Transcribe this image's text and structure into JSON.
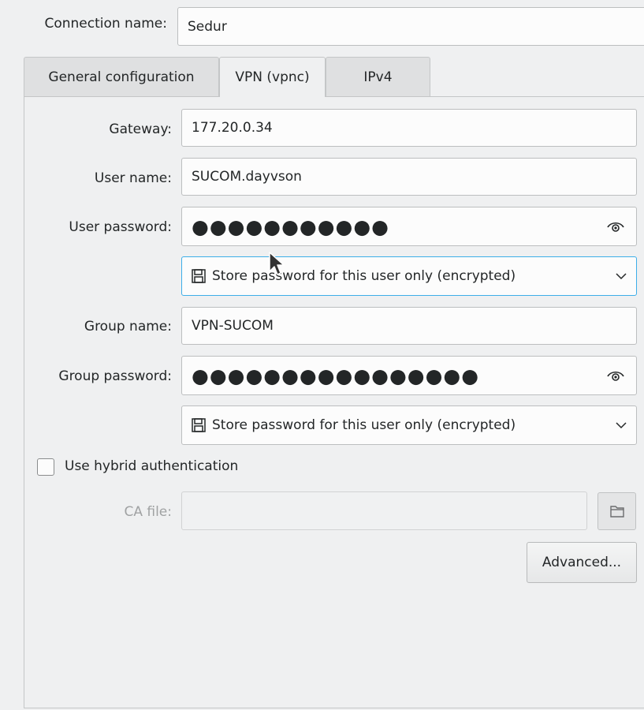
{
  "connection": {
    "label": "Connection name:",
    "value": "Sedur"
  },
  "tabs": [
    {
      "label": "General configuration",
      "active": false
    },
    {
      "label": "VPN (vpnc)",
      "active": true
    },
    {
      "label": "IPv4",
      "active": false
    }
  ],
  "form": {
    "gateway_label": "Gateway:",
    "gateway_value": "177.20.0.34",
    "username_label": "User name:",
    "username_value": "SUCOM.dayvson",
    "user_password_label": "User password:",
    "user_password_masked": "●●●●●●●●●●●",
    "user_password_store": "Store password for this user only (encrypted)",
    "group_name_label": "Group name:",
    "group_name_value": "VPN-SUCOM",
    "group_password_label": "Group password:",
    "group_password_masked": "●●●●●●●●●●●●●●●●",
    "group_password_store": "Store password for this user only (encrypted)",
    "hybrid_auth_label": "Use hybrid authentication",
    "hybrid_auth_checked": false,
    "ca_file_label": "CA file:",
    "ca_file_value": "",
    "advanced_button": "Advanced..."
  },
  "icons": {
    "reveal": "eye-icon",
    "store": "floppy-disk-icon",
    "dropdown": "chevron-down-icon",
    "browse": "folder-icon"
  },
  "colors": {
    "focus_border": "#3daee9",
    "background": "#eff0f1"
  }
}
